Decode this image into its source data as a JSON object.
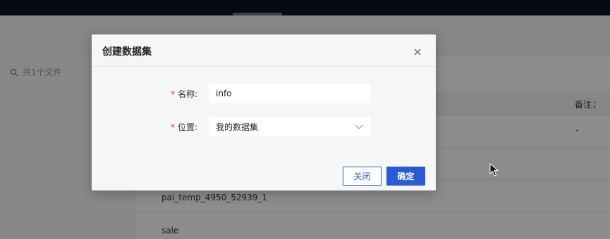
{
  "background": {
    "search_placeholder": "共1个文件",
    "table": {
      "remark_header": "备注",
      "rows": [
        {
          "name": "",
          "remark": "-"
        },
        {
          "name": "",
          "remark": ""
        },
        {
          "name": "pai_temp_4950_52939_1",
          "remark": ""
        },
        {
          "name": "sale",
          "remark": ""
        }
      ]
    }
  },
  "modal": {
    "title": "创建数据集",
    "name_field": {
      "required_mark": "*",
      "label": "名称:",
      "value": "info"
    },
    "location_field": {
      "required_mark": "*",
      "label": "位置:",
      "selected": "我的数据集"
    },
    "close_button": "关闭",
    "confirm_button": "确定"
  },
  "colors": {
    "primary": "#2a5bd7",
    "required": "#e0412b",
    "topbar": "#0b1326"
  },
  "icons": {
    "close": "close-icon",
    "search": "search-icon",
    "dropdown": "chevron-down-icon",
    "sort": "sort-icon"
  }
}
